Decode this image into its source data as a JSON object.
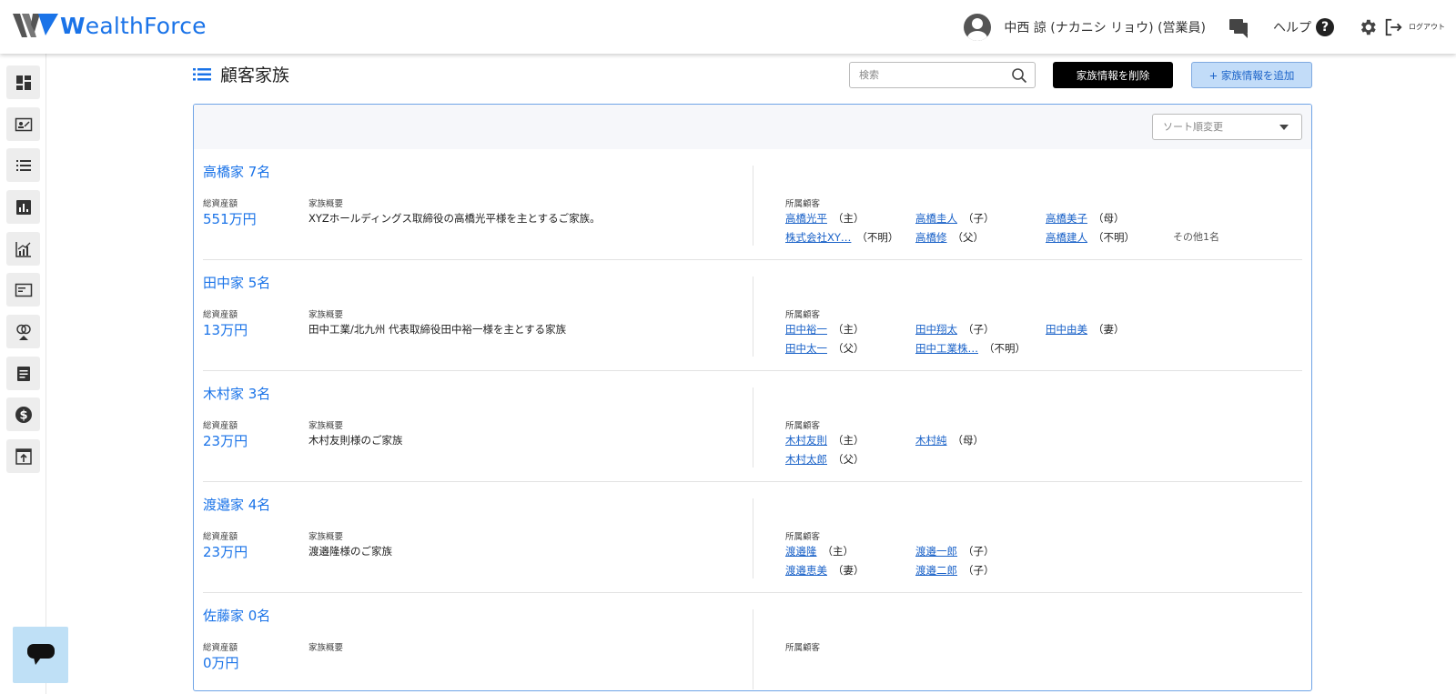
{
  "app": {
    "logo_text_bold": "W",
    "logo_text": "ealthForce",
    "user_name": "中西 諒 (ナカニシ リョウ) (営業員)",
    "help_label": "ヘルプ",
    "help_glyph": "?",
    "logout_label": "ログアウト"
  },
  "page": {
    "title": "顧客家族",
    "search_placeholder": "検索",
    "delete_button": "家族情報を削除",
    "add_button": "+ 家族情報を追加",
    "sort_placeholder": "ソート順変更"
  },
  "labels": {
    "total_assets": "総資産額",
    "summary": "家族概要",
    "members": "所属顧客"
  },
  "families": [
    {
      "name": "高橋家 7名",
      "assets": "551万円",
      "summary": "XYZホールディングス取締役の高橋光平様を主とするご家族。",
      "members": [
        {
          "name": "高橋光平",
          "role": "（主）"
        },
        {
          "name": "高橋圭人",
          "role": "（子）"
        },
        {
          "name": "高橋美子",
          "role": "（母）"
        },
        {
          "name": "株式会社XY…",
          "role": "（不明）"
        },
        {
          "name": "高橋修",
          "role": "（父）"
        },
        {
          "name": "高橋建人",
          "role": "（不明）"
        }
      ],
      "more": "その他1名"
    },
    {
      "name": "田中家 5名",
      "assets": "13万円",
      "summary": "田中工業/北九州 代表取締役田中裕一様を主とする家族",
      "members": [
        {
          "name": "田中裕一",
          "role": "（主）"
        },
        {
          "name": "田中翔太",
          "role": "（子）"
        },
        {
          "name": "田中由美",
          "role": "（妻）"
        },
        {
          "name": "田中太一",
          "role": "（父）"
        },
        {
          "name": "田中工業株…",
          "role": "（不明）"
        }
      ],
      "more": ""
    },
    {
      "name": "木村家 3名",
      "assets": "23万円",
      "summary": "木村友則様のご家族",
      "members": [
        {
          "name": "木村友則",
          "role": "（主）"
        },
        {
          "name": "木村純",
          "role": "（母）"
        },
        {
          "name": "木村太郎",
          "role": "（父）"
        }
      ],
      "more": ""
    },
    {
      "name": "渡邉家 4名",
      "assets": "23万円",
      "summary": "渡邉隆様のご家族",
      "members": [
        {
          "name": "渡邉隆",
          "role": "（主）"
        },
        {
          "name": "渡邉一郎",
          "role": "（子）"
        },
        {
          "name": "渡邉恵美",
          "role": "（妻）"
        },
        {
          "name": "渡邉二郎",
          "role": "（子）"
        }
      ],
      "more": ""
    },
    {
      "name": "佐藤家 0名",
      "assets": "0万円",
      "summary": "",
      "members": [],
      "more": ""
    }
  ],
  "colors": {
    "brand": "#1a73e8",
    "link": "#1a62c8",
    "panel_border": "#6fa4e6",
    "add_button_bg": "#c2dcf8",
    "chat_fab_bg": "#bfe0f6"
  },
  "sidebar_icons": [
    "dashboard-icon",
    "contact-card-icon",
    "list-icon",
    "bar-chart-icon",
    "growth-chart-icon",
    "window-icon",
    "rings-icon",
    "document-icon",
    "dollar-icon",
    "upload-box-icon"
  ]
}
